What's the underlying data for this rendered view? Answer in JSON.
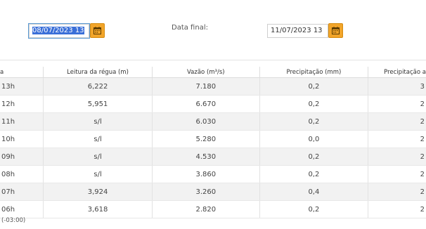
{
  "filters": {
    "start_date_value": "08/07/2023 13",
    "end_label": "Data final:",
    "end_date_value": "11/07/2023 13",
    "calendar_icon": "calendar-icon",
    "accent_color": "#f2a52a"
  },
  "table": {
    "columns": [
      "a",
      "Leitura da régua (m)",
      "Vazão (m³/s)",
      "Precipitação (mm)",
      "Precipitação a"
    ],
    "rows": [
      [
        "13h",
        "6,222",
        "7.180",
        "0,2",
        "3"
      ],
      [
        "12h",
        "5,951",
        "6.670",
        "0,2",
        "2"
      ],
      [
        "11h",
        "s/l",
        "6.030",
        "0,2",
        "2"
      ],
      [
        "10h",
        "s/l",
        "5.280",
        "0,0",
        "2"
      ],
      [
        "09h",
        "s/l",
        "4.530",
        "0,2",
        "2"
      ],
      [
        "08h",
        "s/l",
        "3.860",
        "0,2",
        "2"
      ],
      [
        "07h",
        "3,924",
        "3.260",
        "0,4",
        "2"
      ],
      [
        "06h",
        "3,618",
        "2.820",
        "0,2",
        "2"
      ]
    ]
  },
  "footnote": "(-03:00)"
}
